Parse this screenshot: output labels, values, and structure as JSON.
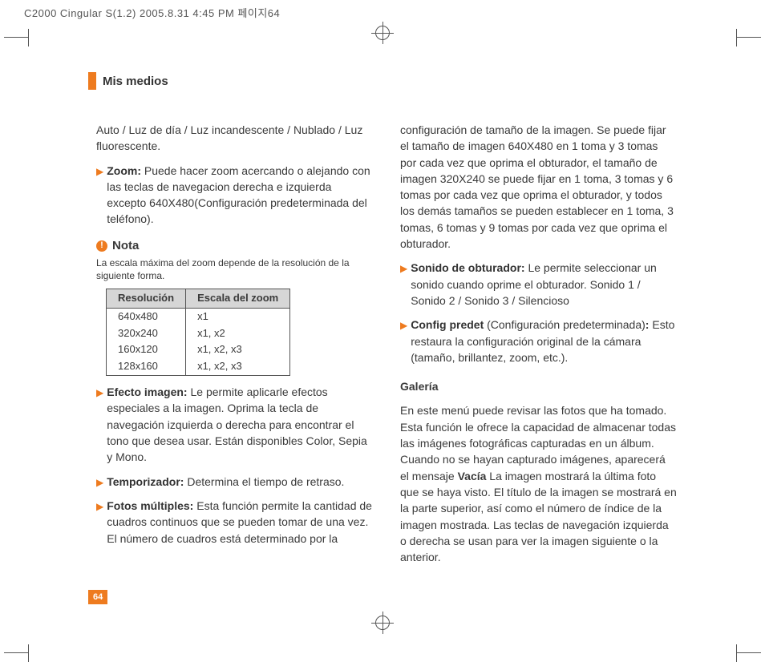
{
  "header_text": "C2000 Cingular S(1.2)  2005.8.31 4:45 PM  페이지64",
  "section_title": "Mis medios",
  "page_number": "64",
  "col1": {
    "light_modes": "Auto / Luz de día / Luz incandescente / Nublado / Luz fluorescente.",
    "zoom_label": "Zoom:",
    "zoom_text": "Puede hacer zoom acercando o alejando con las teclas de navegacion derecha e izquierda excepto 640X480(Configuración predeterminada del teléfono).",
    "note_label": "Nota",
    "note_sub": "La escala máxima del zoom depende de la resolución de la siguiente forma.",
    "table": {
      "h1": "Resolución",
      "h2": "Escala del zoom",
      "rows": [
        {
          "res": "640x480",
          "zoom": "x1"
        },
        {
          "res": "320x240",
          "zoom": "x1,   x2"
        },
        {
          "res": "160x120",
          "zoom": "x1,   x2,   x3"
        },
        {
          "res": "128x160",
          "zoom": "x1,   x2,   x3"
        }
      ]
    },
    "efecto_label": "Efecto imagen:",
    "efecto_text": "Le permite aplicarle efectos especiales a la imagen. Oprima la tecla de navegación izquierda o derecha para encontrar el tono que desea usar. Están disponibles Color, Sepia y Mono.",
    "temp_label": "Temporizador:",
    "temp_text": "Determina el tiempo de retraso.",
    "fotos_label": "Fotos múltiples:",
    "fotos_text": "Esta función permite la cantidad de cuadros continuos que se pueden tomar de una vez. El número de cuadros está determinado por la"
  },
  "col2": {
    "cont_text": "configuración de tamaño de la imagen. Se puede fijar el tamaño de imagen 640X480 en 1 toma y 3 tomas por cada vez que oprima el obturador, el tamaño de imagen 320X240 se puede fijar en 1 toma, 3 tomas y 6 tomas por cada vez que oprima el obturador, y todos los demás tamaños se pueden establecer en 1 toma, 3 tomas, 6 tomas y 9 tomas por cada vez que oprima el obturador.",
    "sonido_label": "Sonido de obturador:",
    "sonido_text": "Le permite seleccionar un sonido cuando oprime el obturador. Sonido 1 / Sonido 2 / Sonido 3 / Silencioso",
    "config_label": "Config predet",
    "config_paren": "(Configuración predeterminada)",
    "config_colon": ":",
    "config_text": "Esto restaura la configuración original de la cámara (tamaño, brillantez, zoom, etc.).",
    "galeria_head": "Galería",
    "galeria_p1a": "En este menú puede revisar las fotos que ha tomado. Esta función le ofrece la capacidad de almacenar todas las imágenes fotográficas capturadas en un álbum. Cuando no se hayan capturado imágenes, aparecerá el mensaje ",
    "galeria_vacia": "Vacía",
    "galeria_p1b": " La imagen mostrará la última foto que se haya visto. El título de la imagen se mostrará en la parte superior, así como el número de índice de la imagen mostrada. Las teclas de navegación izquierda o derecha se usan para ver la imagen siguiente o la anterior."
  }
}
